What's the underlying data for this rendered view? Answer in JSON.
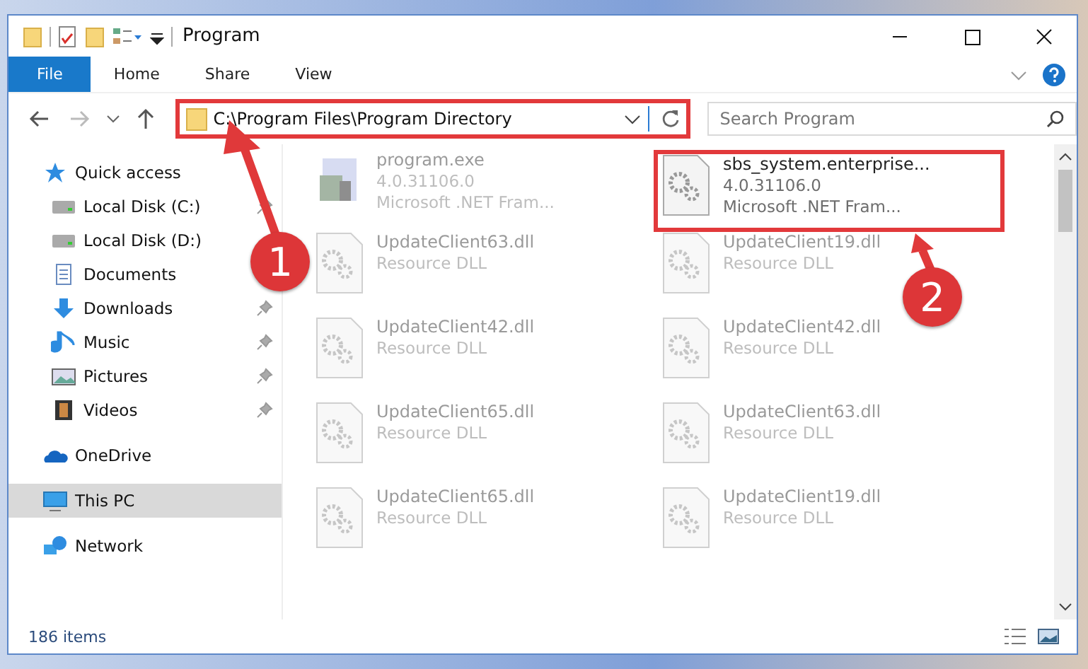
{
  "window": {
    "title": "Program"
  },
  "ribbon_tabs": [
    {
      "label": "File",
      "selected": true
    },
    {
      "label": "Home",
      "selected": false
    },
    {
      "label": "Share",
      "selected": false
    },
    {
      "label": "View",
      "selected": false
    }
  ],
  "address_bar": {
    "path": "C:\\Program Files\\Program Directory",
    "highlighted": true
  },
  "search": {
    "placeholder": "Search Program"
  },
  "sidebar": {
    "items": [
      {
        "label": "Quick access",
        "kind": "star",
        "selected": false,
        "children": [
          {
            "label": "Local Disk (C:)",
            "kind": "drive",
            "pinned": true,
            "selected": false
          },
          {
            "label": "Local Disk (D:)",
            "kind": "drive",
            "pinned": false,
            "selected": false
          },
          {
            "label": "Documents",
            "kind": "documents",
            "pinned": false,
            "selected": false
          },
          {
            "label": "Downloads",
            "kind": "downloads",
            "pinned": true,
            "selected": false
          },
          {
            "label": "Music",
            "kind": "music",
            "pinned": true,
            "selected": false
          },
          {
            "label": "Pictures",
            "kind": "pictures",
            "pinned": true,
            "selected": false
          },
          {
            "label": "Videos",
            "kind": "videos",
            "pinned": true,
            "selected": false
          }
        ]
      },
      {
        "label": "OneDrive",
        "kind": "cloud",
        "selected": false
      },
      {
        "label": "This PC",
        "kind": "pc",
        "selected": true
      },
      {
        "label": "Network",
        "kind": "network",
        "selected": false
      }
    ]
  },
  "files": [
    {
      "name": "program.exe",
      "details": [
        "4.0.31106.0",
        "Microsoft .NET Fram..."
      ],
      "kind": "exe",
      "faded": true
    },
    {
      "name": "sbs_system.enterprise...",
      "details": [
        "4.0.31106.0",
        "Microsoft .NET Fram..."
      ],
      "kind": "dll",
      "faded": false,
      "highlighted": true
    },
    {
      "name": "UpdateClient63.dll",
      "details": [
        "Resource DLL"
      ],
      "kind": "dll",
      "faded": true
    },
    {
      "name": "UpdateClient19.dll",
      "details": [
        "Resource DLL"
      ],
      "kind": "dll",
      "faded": true
    },
    {
      "name": "UpdateClient42.dll",
      "details": [
        "Resource DLL"
      ],
      "kind": "dll",
      "faded": true
    },
    {
      "name": "UpdateClient42.dll",
      "details": [
        "Resource DLL"
      ],
      "kind": "dll",
      "faded": true
    },
    {
      "name": "UpdateClient65.dll",
      "details": [
        "Resource DLL"
      ],
      "kind": "dll",
      "faded": true
    },
    {
      "name": "UpdateClient63.dll",
      "details": [
        "Resource DLL"
      ],
      "kind": "dll",
      "faded": true
    },
    {
      "name": "UpdateClient65.dll",
      "details": [
        "Resource DLL"
      ],
      "kind": "dll",
      "faded": true
    },
    {
      "name": "UpdateClient19.dll",
      "details": [
        "Resource DLL"
      ],
      "kind": "dll",
      "faded": true
    }
  ],
  "status_bar": {
    "item_count": "186 items"
  },
  "callouts": [
    {
      "number": "1"
    },
    {
      "number": "2"
    }
  ]
}
